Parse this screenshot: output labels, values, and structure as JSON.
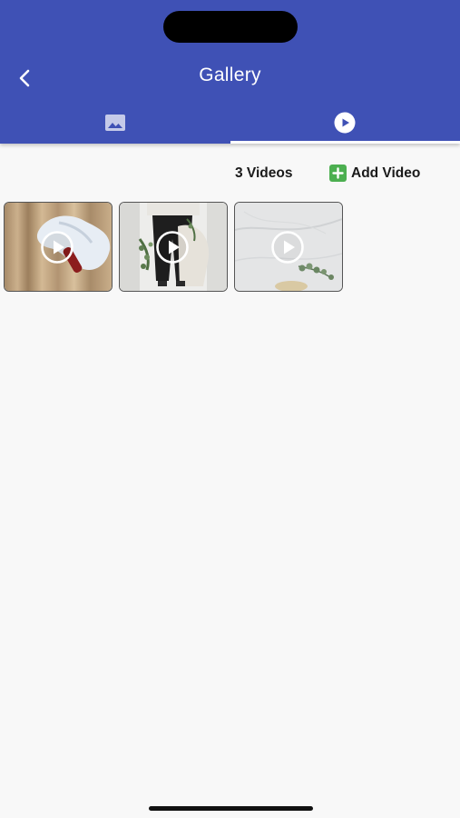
{
  "header": {
    "title": "Gallery",
    "background": "#3f51b5",
    "back_icon": "chevron-left-icon"
  },
  "tabs": [
    {
      "icon": "image-icon",
      "selected": false
    },
    {
      "icon": "play-circle-icon",
      "selected": true
    }
  ],
  "videos": {
    "count_label": "3 Videos",
    "add_label": "Add Video",
    "add_icon": "plus-square-icon",
    "add_color": "#4caf50",
    "items": [
      {
        "thumbnail": "gloved hand holding red tube",
        "icon": "play-icon"
      },
      {
        "thumbnail": "person holding bag with greenery",
        "icon": "play-icon"
      },
      {
        "thumbnail": "marble surface with eucalyptus",
        "icon": "play-icon"
      }
    ]
  }
}
